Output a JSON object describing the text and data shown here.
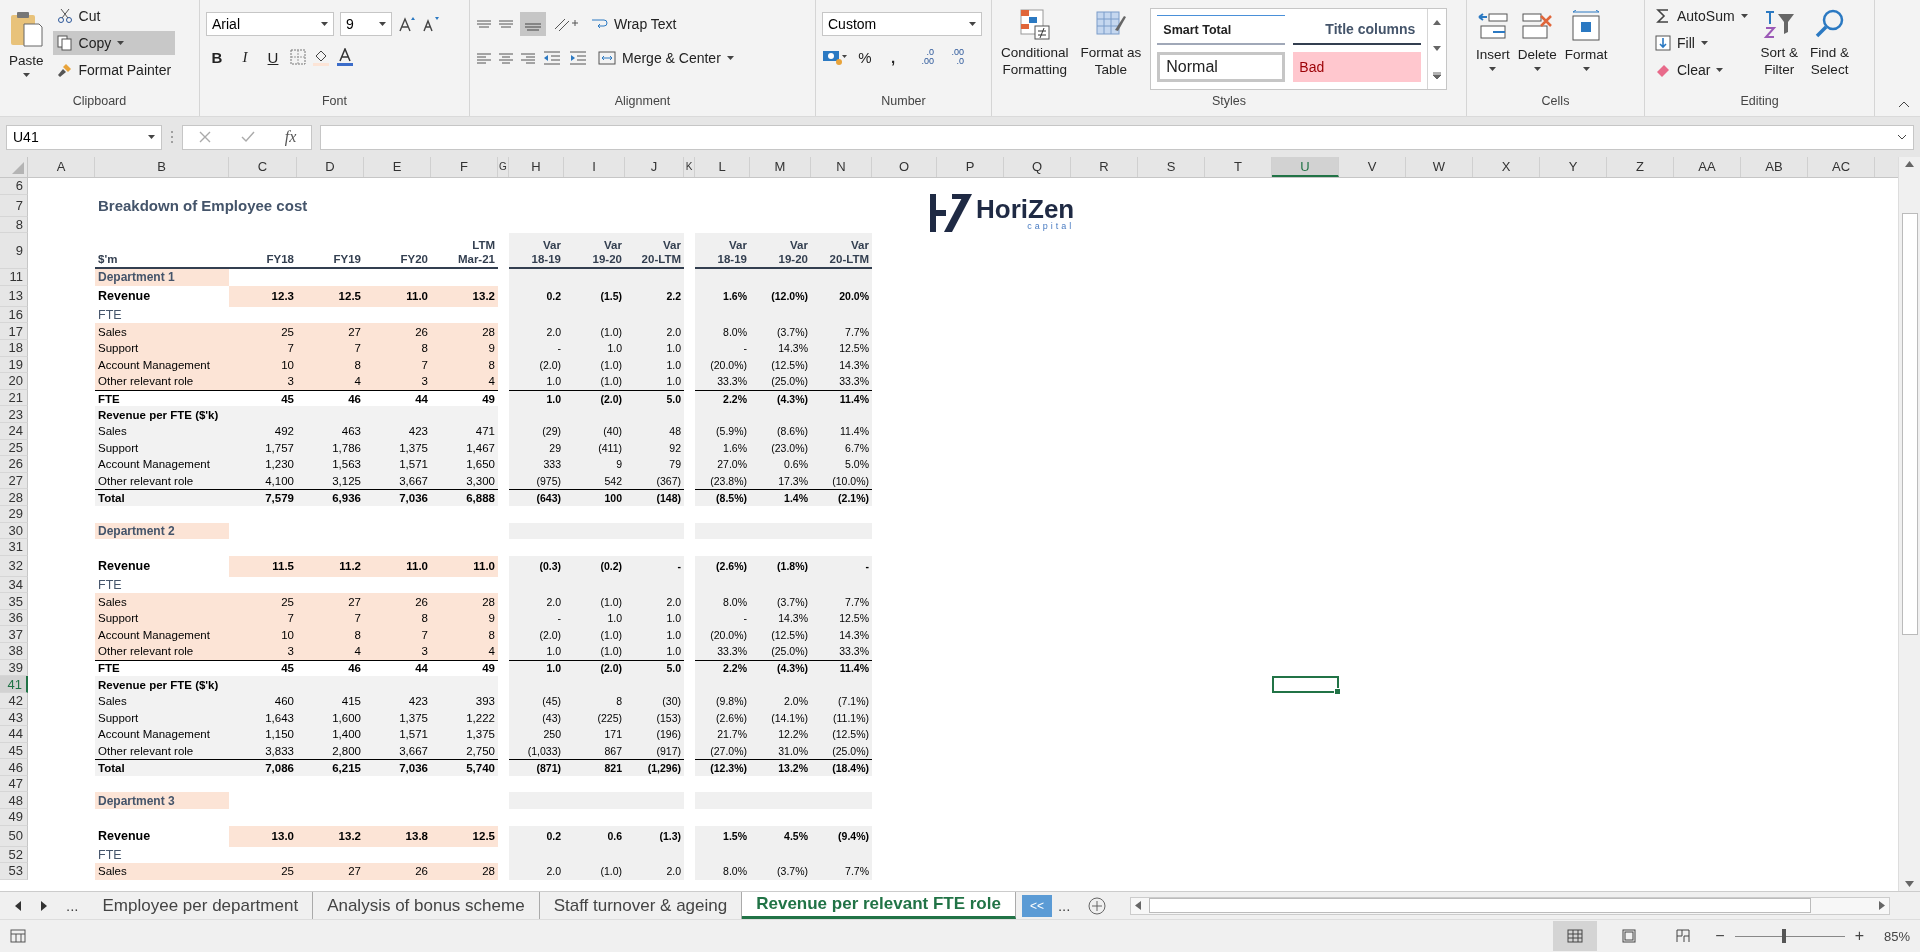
{
  "ribbon": {
    "clipboard": {
      "label": "Clipboard",
      "paste": "Paste",
      "cut": "Cut",
      "copy": "Copy",
      "copy_selected": true,
      "format_painter": "Format Painter"
    },
    "font": {
      "label": "Font",
      "family": "Arial",
      "size": "9",
      "bold": "B",
      "italic": "I",
      "underline": "U"
    },
    "alignment": {
      "label": "Alignment",
      "wrap_text": "Wrap Text",
      "merge_center": "Merge & Center"
    },
    "number": {
      "label": "Number",
      "format": "Custom",
      "percent": "%",
      "comma": ",",
      "increase_decimal": [
        ".0",
        ".00"
      ],
      "decrease_decimal": [
        ".00",
        ".0"
      ]
    },
    "styles": {
      "label": "Styles",
      "conditional": [
        "Conditional",
        "Formatting"
      ],
      "format_table": [
        "Format as",
        "Table"
      ],
      "gallery": [
        {
          "name": "Smart Total",
          "kind": "smart_total"
        },
        {
          "name": "Title columns",
          "kind": "title_columns"
        },
        {
          "name": "Normal",
          "kind": "normal"
        },
        {
          "name": "Bad",
          "kind": "bad"
        }
      ]
    },
    "cells": {
      "label": "Cells",
      "buttons": [
        {
          "label": "Insert",
          "kind": "insert"
        },
        {
          "label": "Delete",
          "kind": "delete"
        },
        {
          "label": "Format",
          "kind": "format"
        }
      ]
    },
    "editing": {
      "label": "Editing",
      "autosum": "AutoSum",
      "fill": "Fill",
      "clear": "Clear",
      "sort": [
        "Sort &",
        "Filter"
      ],
      "find": [
        "Find &",
        "Select"
      ]
    }
  },
  "formula_bar": {
    "name_box": "U41",
    "fx": "fx"
  },
  "columns": [
    {
      "letter": "A",
      "selected": false
    },
    {
      "letter": "B",
      "selected": false
    },
    {
      "letter": "C",
      "selected": false
    },
    {
      "letter": "D",
      "selected": false
    },
    {
      "letter": "E",
      "selected": false
    },
    {
      "letter": "F",
      "selected": false
    },
    {
      "letter": "G",
      "selected": false
    },
    {
      "letter": "H",
      "selected": false
    },
    {
      "letter": "I",
      "selected": false
    },
    {
      "letter": "J",
      "selected": false
    },
    {
      "letter": "K",
      "selected": false
    },
    {
      "letter": "L",
      "selected": false
    },
    {
      "letter": "M",
      "selected": false
    },
    {
      "letter": "N",
      "selected": false
    },
    {
      "letter": "O",
      "selected": false
    },
    {
      "letter": "P",
      "selected": false
    },
    {
      "letter": "Q",
      "selected": false
    },
    {
      "letter": "R",
      "selected": false
    },
    {
      "letter": "S",
      "selected": false
    },
    {
      "letter": "T",
      "selected": false
    },
    {
      "letter": "U",
      "selected": true
    },
    {
      "letter": "V",
      "selected": false
    },
    {
      "letter": "W",
      "selected": false
    },
    {
      "letter": "X",
      "selected": false
    },
    {
      "letter": "Y",
      "selected": false
    },
    {
      "letter": "Z",
      "selected": false
    },
    {
      "letter": "AA",
      "selected": false
    },
    {
      "letter": "AB",
      "selected": false
    },
    {
      "letter": "AC",
      "selected": false
    }
  ],
  "logo": {
    "name": "HoriZen",
    "tagline": "capital"
  },
  "rows": [
    {
      "number": "6",
      "kind": "blank",
      "selected": false
    },
    {
      "number": "7",
      "kind": "title",
      "selected": false,
      "label": "Breakdown of Employee cost"
    },
    {
      "number": "8",
      "kind": "blank",
      "selected": false
    },
    {
      "number": "9",
      "kind": "header",
      "selected": false,
      "label": "$'m",
      "values": [
        [
          "FY18"
        ],
        [
          "FY19"
        ],
        [
          "FY20"
        ],
        [
          "LTM",
          "Mar-21"
        ]
      ],
      "var": [
        [
          "Var",
          "18-19"
        ],
        [
          "Var",
          "19-20"
        ],
        [
          "Var",
          "20-LTM"
        ]
      ],
      "pct": [
        [
          "Var",
          "18-19"
        ],
        [
          "Var",
          "19-20"
        ],
        [
          "Var",
          "20-LTM"
        ]
      ]
    },
    {
      "number": "11",
      "kind": "section",
      "selected": false,
      "label": "Department 1"
    },
    {
      "number": "13",
      "kind": "revenue",
      "selected": false,
      "label": "Revenue",
      "values": [
        "12.3",
        "12.5",
        "11.0",
        "13.2"
      ],
      "var": [
        "0.2",
        "(1.5)",
        "2.2"
      ],
      "pct": [
        "1.6%",
        "(12.0%)",
        "20.0%"
      ]
    },
    {
      "number": "16",
      "kind": "subhead",
      "selected": false,
      "label": "FTE"
    },
    {
      "number": "17",
      "kind": "input",
      "selected": false,
      "label": "Sales",
      "values": [
        "25",
        "27",
        "26",
        "28"
      ],
      "var": [
        "2.0",
        "(1.0)",
        "2.0"
      ],
      "pct": [
        "8.0%",
        "(3.7%)",
        "7.7%"
      ]
    },
    {
      "number": "18",
      "kind": "input",
      "selected": false,
      "label": "Support",
      "values": [
        "7",
        "7",
        "8",
        "9"
      ],
      "var": [
        "-",
        "1.0",
        "1.0"
      ],
      "pct": [
        "-",
        "14.3%",
        "12.5%"
      ]
    },
    {
      "number": "19",
      "kind": "input",
      "selected": false,
      "label": "Account Management",
      "values": [
        "10",
        "8",
        "7",
        "8"
      ],
      "var": [
        "(2.0)",
        "(1.0)",
        "1.0"
      ],
      "pct": [
        "(20.0%)",
        "(12.5%)",
        "14.3%"
      ]
    },
    {
      "number": "20",
      "kind": "input",
      "selected": false,
      "label": "Other relevant role",
      "values": [
        "3",
        "4",
        "3",
        "4"
      ],
      "var": [
        "1.0",
        "(1.0)",
        "1.0"
      ],
      "pct": [
        "33.3%",
        "(25.0%)",
        "33.3%"
      ]
    },
    {
      "number": "21",
      "kind": "total_fte",
      "selected": false,
      "label": "FTE",
      "values": [
        "45",
        "46",
        "44",
        "49"
      ],
      "var": [
        "1.0",
        "(2.0)",
        "5.0"
      ],
      "pct": [
        "2.2%",
        "(4.3%)",
        "11.4%"
      ]
    },
    {
      "number": "23",
      "kind": "ratio_header",
      "selected": false,
      "label": "Revenue per FTE ($'k)"
    },
    {
      "number": "24",
      "kind": "ratio",
      "selected": false,
      "label": "Sales",
      "values": [
        "492",
        "463",
        "423",
        "471"
      ],
      "var": [
        "(29)",
        "(40)",
        "48"
      ],
      "pct": [
        "(5.9%)",
        "(8.6%)",
        "11.4%"
      ]
    },
    {
      "number": "25",
      "kind": "ratio",
      "selected": false,
      "label": "Support",
      "values": [
        "1,757",
        "1,786",
        "1,375",
        "1,467"
      ],
      "var": [
        "29",
        "(411)",
        "92"
      ],
      "pct": [
        "1.6%",
        "(23.0%)",
        "6.7%"
      ]
    },
    {
      "number": "26",
      "kind": "ratio",
      "selected": false,
      "label": "Account Management",
      "values": [
        "1,230",
        "1,563",
        "1,571",
        "1,650"
      ],
      "var": [
        "333",
        "9",
        "79"
      ],
      "pct": [
        "27.0%",
        "0.6%",
        "5.0%"
      ]
    },
    {
      "number": "27",
      "kind": "ratio",
      "selected": false,
      "label": "Other relevant role",
      "values": [
        "4,100",
        "3,125",
        "3,667",
        "3,300"
      ],
      "var": [
        "(975)",
        "542",
        "(367)"
      ],
      "pct": [
        "(23.8%)",
        "17.3%",
        "(10.0%)"
      ]
    },
    {
      "number": "28",
      "kind": "total",
      "selected": false,
      "label": "Total",
      "values": [
        "7,579",
        "6,936",
        "7,036",
        "6,888"
      ],
      "var": [
        "(643)",
        "100",
        "(148)"
      ],
      "pct": [
        "(8.5%)",
        "1.4%",
        "(2.1%)"
      ]
    },
    {
      "number": "29",
      "kind": "blank",
      "selected": false
    },
    {
      "number": "30",
      "kind": "section",
      "selected": false,
      "label": "Department 2"
    },
    {
      "number": "31",
      "kind": "blank",
      "selected": false
    },
    {
      "number": "32",
      "kind": "revenue",
      "selected": false,
      "label": "Revenue",
      "values": [
        "11.5",
        "11.2",
        "11.0",
        "11.0"
      ],
      "var": [
        "(0.3)",
        "(0.2)",
        "-"
      ],
      "pct": [
        "(2.6%)",
        "(1.8%)",
        "-"
      ]
    },
    {
      "number": "34",
      "kind": "subhead",
      "selected": false,
      "label": "FTE"
    },
    {
      "number": "35",
      "kind": "input",
      "selected": false,
      "label": "Sales",
      "values": [
        "25",
        "27",
        "26",
        "28"
      ],
      "var": [
        "2.0",
        "(1.0)",
        "2.0"
      ],
      "pct": [
        "8.0%",
        "(3.7%)",
        "7.7%"
      ]
    },
    {
      "number": "36",
      "kind": "input",
      "selected": false,
      "label": "Support",
      "values": [
        "7",
        "7",
        "8",
        "9"
      ],
      "var": [
        "-",
        "1.0",
        "1.0"
      ],
      "pct": [
        "-",
        "14.3%",
        "12.5%"
      ]
    },
    {
      "number": "37",
      "kind": "input",
      "selected": false,
      "label": "Account Management",
      "values": [
        "10",
        "8",
        "7",
        "8"
      ],
      "var": [
        "(2.0)",
        "(1.0)",
        "1.0"
      ],
      "pct": [
        "(20.0%)",
        "(12.5%)",
        "14.3%"
      ]
    },
    {
      "number": "38",
      "kind": "input",
      "selected": false,
      "label": "Other relevant role",
      "values": [
        "3",
        "4",
        "3",
        "4"
      ],
      "var": [
        "1.0",
        "(1.0)",
        "1.0"
      ],
      "pct": [
        "33.3%",
        "(25.0%)",
        "33.3%"
      ]
    },
    {
      "number": "39",
      "kind": "total_fte",
      "selected": false,
      "label": "FTE",
      "values": [
        "45",
        "46",
        "44",
        "49"
      ],
      "var": [
        "1.0",
        "(2.0)",
        "5.0"
      ],
      "pct": [
        "2.2%",
        "(4.3%)",
        "11.4%"
      ]
    },
    {
      "number": "41",
      "kind": "ratio_header",
      "selected": true,
      "label": "Revenue per FTE ($'k)"
    },
    {
      "number": "42",
      "kind": "ratio",
      "selected": false,
      "label": "Sales",
      "values": [
        "460",
        "415",
        "423",
        "393"
      ],
      "var": [
        "(45)",
        "8",
        "(30)"
      ],
      "pct": [
        "(9.8%)",
        "2.0%",
        "(7.1%)"
      ]
    },
    {
      "number": "43",
      "kind": "ratio",
      "selected": false,
      "label": "Support",
      "values": [
        "1,643",
        "1,600",
        "1,375",
        "1,222"
      ],
      "var": [
        "(43)",
        "(225)",
        "(153)"
      ],
      "pct": [
        "(2.6%)",
        "(14.1%)",
        "(11.1%)"
      ]
    },
    {
      "number": "44",
      "kind": "ratio",
      "selected": false,
      "label": "Account Management",
      "values": [
        "1,150",
        "1,400",
        "1,571",
        "1,375"
      ],
      "var": [
        "250",
        "171",
        "(196)"
      ],
      "pct": [
        "21.7%",
        "12.2%",
        "(12.5%)"
      ]
    },
    {
      "number": "45",
      "kind": "ratio",
      "selected": false,
      "label": "Other relevant role",
      "values": [
        "3,833",
        "2,800",
        "3,667",
        "2,750"
      ],
      "var": [
        "(1,033)",
        "867",
        "(917)"
      ],
      "pct": [
        "(27.0%)",
        "31.0%",
        "(25.0%)"
      ]
    },
    {
      "number": "46",
      "kind": "total",
      "selected": false,
      "label": "Total",
      "values": [
        "7,086",
        "6,215",
        "7,036",
        "5,740"
      ],
      "var": [
        "(871)",
        "821",
        "(1,296)"
      ],
      "pct": [
        "(12.3%)",
        "13.2%",
        "(18.4%)"
      ]
    },
    {
      "number": "47",
      "kind": "blank",
      "selected": false
    },
    {
      "number": "48",
      "kind": "section",
      "selected": false,
      "label": "Department 3"
    },
    {
      "number": "49",
      "kind": "blank",
      "selected": false
    },
    {
      "number": "50",
      "kind": "revenue",
      "selected": false,
      "label": "Revenue",
      "values": [
        "13.0",
        "13.2",
        "13.8",
        "12.5"
      ],
      "var": [
        "0.2",
        "0.6",
        "(1.3)"
      ],
      "pct": [
        "1.5%",
        "4.5%",
        "(9.4%)"
      ]
    },
    {
      "number": "52",
      "kind": "subhead",
      "selected": false,
      "label": "FTE"
    },
    {
      "number": "53",
      "kind": "input",
      "selected": false,
      "label": "Sales",
      "values": [
        "25",
        "27",
        "26",
        "28"
      ],
      "var": [
        "2.0",
        "(1.0)",
        "2.0"
      ],
      "pct": [
        "8.0%",
        "(3.7%)",
        "7.7%"
      ]
    }
  ],
  "sheet_tabs": {
    "more_left": "...",
    "tabs": [
      {
        "label": "Employee per department",
        "selected": false
      },
      {
        "label": "Analysis of bonus scheme",
        "selected": false
      },
      {
        "label": "Staff turnover & ageing",
        "selected": false
      },
      {
        "label": "Revenue per relevant FTE role",
        "selected": true
      }
    ],
    "overflow_tab": "<<",
    "more_right": "..."
  },
  "status_bar": {
    "zoom_out": "−",
    "zoom_in": "+",
    "zoom": "85%",
    "zoom_slider": {
      "level": 0.45
    }
  }
}
